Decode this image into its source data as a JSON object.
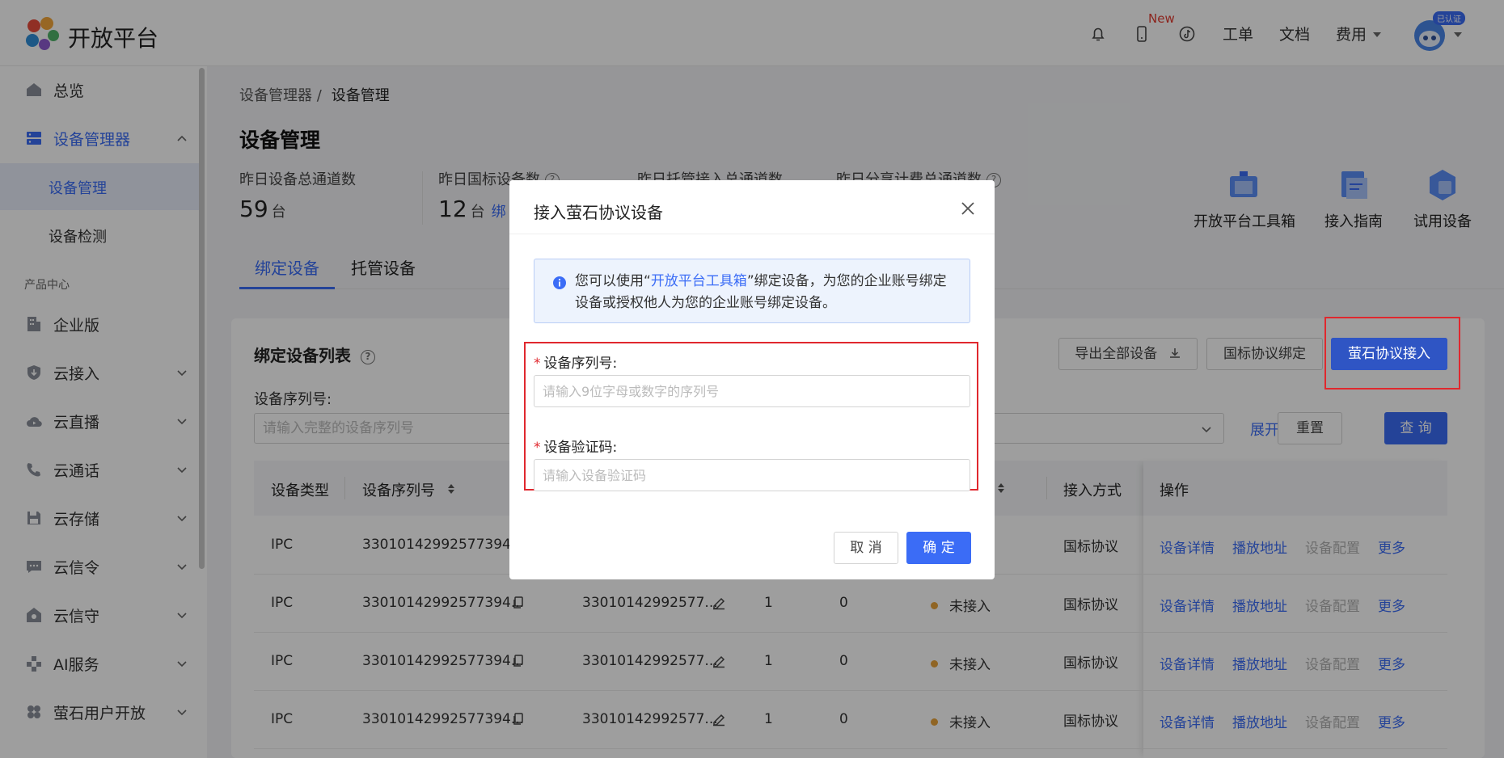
{
  "header": {
    "brand": "开放平台",
    "new_badge": "New",
    "links": {
      "ticket": "工单",
      "docs": "文档",
      "fees": "费用"
    },
    "avatar_badge": "已认证"
  },
  "sidebar": {
    "items": [
      {
        "label": "总览"
      },
      {
        "label": "设备管理器"
      },
      {
        "label": "设备管理"
      },
      {
        "label": "设备检测"
      },
      {
        "label": "企业版"
      },
      {
        "label": "云接入"
      },
      {
        "label": "云直播"
      },
      {
        "label": "云通话"
      },
      {
        "label": "云存储"
      },
      {
        "label": "云信令"
      },
      {
        "label": "云信守"
      },
      {
        "label": "AI服务"
      },
      {
        "label": "萤石用户开放"
      }
    ],
    "section_label": "产品中心"
  },
  "breadcrumb": {
    "parent": "设备管理器 /",
    "current": "设备管理"
  },
  "page_title": "设备管理",
  "stats": [
    {
      "label": "昨日设备总通道数",
      "value": "59",
      "unit": "台"
    },
    {
      "label": "昨日国标设备数",
      "value": "12",
      "unit": "台",
      "link": "绑"
    },
    {
      "label": "昨日托管接入总通道数"
    },
    {
      "label": "昨日分享计费总通道数"
    }
  ],
  "tools": [
    {
      "label": "开放平台工具箱"
    },
    {
      "label": "接入指南"
    },
    {
      "label": "试用设备"
    }
  ],
  "tabs": [
    {
      "label": "绑定设备"
    },
    {
      "label": "托管设备"
    }
  ],
  "list": {
    "title": "绑定设备列表",
    "buttons": {
      "export": "导出全部设备",
      "gb_bind": "国标协议绑定",
      "ezviz_access": "萤石协议接入"
    },
    "filter_label": "设备序列号:",
    "filter_placeholder": "请输入完整的设备序列号",
    "expand": "展开",
    "reset": "重置",
    "query": "查 询",
    "columns": {
      "type": "设备类型",
      "serial": "设备序列号",
      "access": "接入方式",
      "ops": "操作"
    },
    "rows": [
      {
        "type": "IPC",
        "serial": "33010142992577394...",
        "code": "",
        "channels": "",
        "online": "",
        "status": "",
        "access": "国标协议"
      },
      {
        "type": "IPC",
        "serial": "33010142992577394...",
        "code": "33010142992577...",
        "channels": "1",
        "online": "0",
        "status": "未接入",
        "access": "国标协议"
      },
      {
        "type": "IPC",
        "serial": "33010142992577394...",
        "code": "33010142992577...",
        "channels": "1",
        "online": "0",
        "status": "未接入",
        "access": "国标协议"
      },
      {
        "type": "IPC",
        "serial": "33010142992577394...",
        "code": "33010142992577...",
        "channels": "1",
        "online": "0",
        "status": "未接入",
        "access": "国标协议"
      }
    ],
    "ops": {
      "detail": "设备详情",
      "play": "播放地址",
      "config": "设备配置",
      "more": "更多"
    }
  },
  "modal": {
    "title": "接入萤石协议设备",
    "info_prefix": "您可以使用“",
    "info_link": "开放平台工具箱",
    "info_suffix": "”绑定设备，为您的企业账号绑定设备或授权他人为您的企业账号绑定设备。",
    "serial_label": "设备序列号:",
    "serial_placeholder": "请输入9位字母或数字的序列号",
    "code_label": "设备验证码:",
    "code_placeholder": "请输入设备验证码",
    "required_mark": "*",
    "cancel": "取 消",
    "confirm": "确 定"
  },
  "colors": {
    "accent": "#3b6cf6",
    "highlight": "#e0282e",
    "pending": "#e8a33a"
  }
}
